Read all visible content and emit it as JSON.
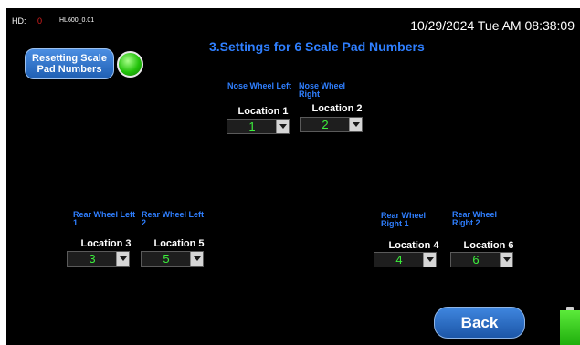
{
  "header": {
    "hd_label": "HD:",
    "hd_value": "0",
    "model": "HL600_0.01",
    "datetime": "10/29/2024 Tue AM 08:38:09"
  },
  "page": {
    "title": "3.Settings for 6 Scale Pad Numbers"
  },
  "reset_button": {
    "label": "Resetting Scale\nPad Numbers"
  },
  "pads": [
    {
      "wheel": "Nose Wheel Left",
      "location": "Location 1",
      "value": "1"
    },
    {
      "wheel": "Nose Wheel Right",
      "location": "Location 2",
      "value": "2"
    },
    {
      "wheel": "Rear Wheel Left 1",
      "location": "Location 3",
      "value": "3"
    },
    {
      "wheel": "Rear Wheel Left 2",
      "location": "Location 5",
      "value": "5"
    },
    {
      "wheel": "Rear Wheel Right 1",
      "location": "Location 4",
      "value": "4"
    },
    {
      "wheel": "Rear Wheel Right 2",
      "location": "Location 6",
      "value": "6"
    }
  ],
  "footer": {
    "back_label": "Back"
  },
  "colors": {
    "background": "#000000",
    "title": "#2f7fff",
    "value": "#3cf03c",
    "status_led": "#22c20a",
    "battery": "#3ad420"
  },
  "icons": {
    "status": "status-led-icon",
    "battery": "battery-icon",
    "dropdown": "chevron-down-icon"
  }
}
